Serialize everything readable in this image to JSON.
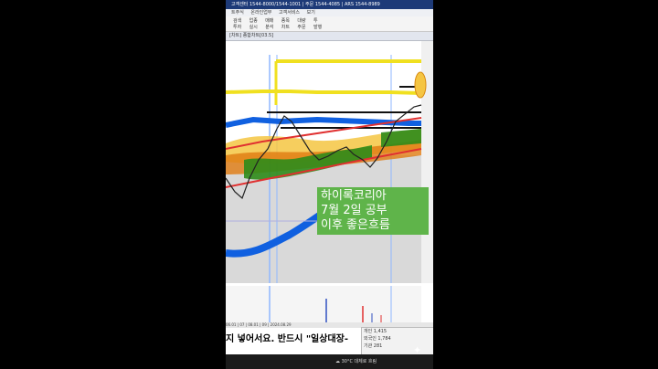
{
  "window": {
    "title_bar": "고객센터 1544-8000/1544-1001 | 주문 1544-4085 | ARS 1544-8989",
    "menu_items": [
      "트주식",
      "온라인업무",
      "고객서비스",
      "보기"
    ],
    "toolbar_row1": [
      "검색",
      "업종",
      "매매",
      "종목",
      "대량",
      "투"
    ],
    "toolbar_row2": [
      "투자",
      "실시",
      "분석",
      "차트",
      "주문",
      "발행"
    ],
    "tab_label": "[차트] 종합차트[03.5]"
  },
  "overlay": {
    "line1": "하이록코리아",
    "line2": "7월 2일 공부",
    "line3": "이후 좋은흐름"
  },
  "status_bar": "06.01 | 07 | 08.01 | 09 | 2024.08.29",
  "subtitle": "지 넣어서요. 반드시 \"일상대장-",
  "right_panel": {
    "rows": [
      {
        "label": "개인",
        "value": "1,415"
      },
      {
        "label": "외국인",
        "value": "1,784"
      },
      {
        "label": "기관",
        "value": "281"
      }
    ]
  },
  "taskbar": {
    "weather": "30°C 대체로 흐림",
    "time": ""
  },
  "colors": {
    "title_bar": "#1d3a78",
    "yellow_band": "#f0e020",
    "blue_band": "#1060e0",
    "orange_band": "#e07a10",
    "green_cloud": "#2e8b1a",
    "red_line": "#e03030",
    "overlay_bg": "#5fb44a"
  }
}
